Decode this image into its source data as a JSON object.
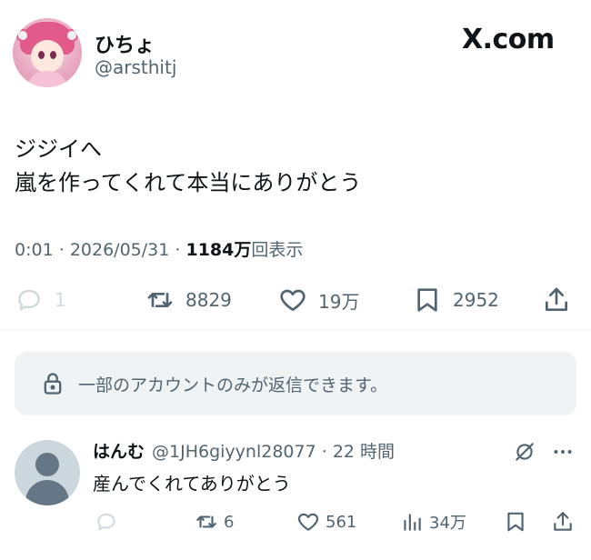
{
  "author": {
    "display_name": "ひちょ",
    "handle": "@arsthitj"
  },
  "brand": "X.com",
  "tweet": {
    "line1": "ジジイへ",
    "line2": "嵐を作ってくれて本当にありがとう"
  },
  "meta": {
    "time": "0:01",
    "date": "2026/05/31",
    "views_count": "1184万",
    "views_label": "回表示"
  },
  "actions": {
    "reply_count": "1",
    "retweet_count": "8829",
    "like_count": "19万",
    "bookmark_count": "2952"
  },
  "restriction": {
    "text": "一部のアカウントのみが返信できます。"
  },
  "reply": {
    "display_name": "はんむ",
    "handle": "@1JH6giyynl28077",
    "time": "22 時間",
    "text": "産んでくれてありがとう",
    "retweet_count": "6",
    "like_count": "561",
    "views_count": "34万"
  },
  "colors": {
    "text": "#0f1419",
    "secondary": "#536471",
    "disabled": "#cfd9de",
    "box_bg": "#eff3f4"
  }
}
